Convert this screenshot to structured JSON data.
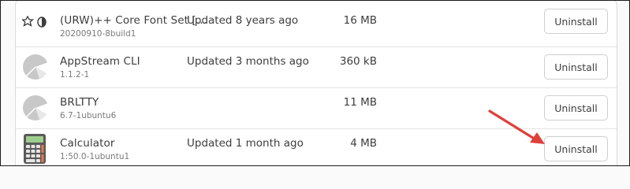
{
  "apps": [
    {
      "name": "(URW)++ Core Font Set […",
      "version": "20200910-8build1",
      "updated": "Updated 8 years ago",
      "size": "16 MB",
      "action": "Uninstall",
      "icon": "font-symbols-icon"
    },
    {
      "name": "AppStream CLI",
      "version": "1.1.2-1",
      "updated": "Updated 3 months ago",
      "size": "360 kB",
      "action": "Uninstall",
      "icon": "generic-app-icon"
    },
    {
      "name": "BRLTTY",
      "version": "6.7-1ubuntu6",
      "updated": "",
      "size": "11 MB",
      "action": "Uninstall",
      "icon": "generic-app-icon"
    },
    {
      "name": "Calculator",
      "version": "1:50.0-1ubuntu1",
      "updated": "Updated 1 month ago",
      "size": "4 MB",
      "action": "Uninstall",
      "icon": "calculator-icon"
    }
  ],
  "colors": {
    "arrow": "#e0403a",
    "border": "#dadada",
    "text": "#3d3d3d",
    "subtext": "#7a7a7a"
  }
}
